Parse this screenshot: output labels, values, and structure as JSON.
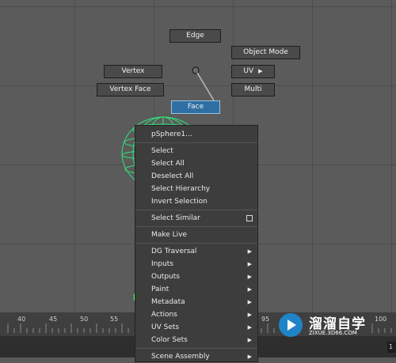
{
  "marking_menu": {
    "edge": "Edge",
    "object_mode": "Object Mode",
    "vertex": "Vertex",
    "uv": "UV",
    "vertex_face": "Vertex Face",
    "multi": "Multi",
    "face": "Face"
  },
  "context_menu": {
    "header": "pSphere1...",
    "items": [
      {
        "label": "Select"
      },
      {
        "label": "Select All"
      },
      {
        "label": "Deselect All"
      },
      {
        "label": "Select Hierarchy"
      },
      {
        "label": "Invert Selection"
      },
      {
        "label": "Select Similar"
      },
      {
        "label": "Make Live"
      },
      {
        "label": "DG Traversal"
      },
      {
        "label": "Inputs"
      },
      {
        "label": "Outputs"
      },
      {
        "label": "Paint"
      },
      {
        "label": "Metadata"
      },
      {
        "label": "Actions"
      },
      {
        "label": "UV Sets"
      },
      {
        "label": "Color Sets"
      },
      {
        "label": "Scene Assembly"
      }
    ]
  },
  "timeline": {
    "ticks": [
      "40",
      "45",
      "50",
      "55",
      "95",
      "100"
    ]
  },
  "corner_value": "1",
  "watermark": {
    "title": "溜溜自学",
    "url": "ZIXUE.3D66.COM"
  },
  "colors": {
    "viewport": "#5b5b5b",
    "selected": "#2f6fa3",
    "wireframe": "#2fe57a"
  }
}
